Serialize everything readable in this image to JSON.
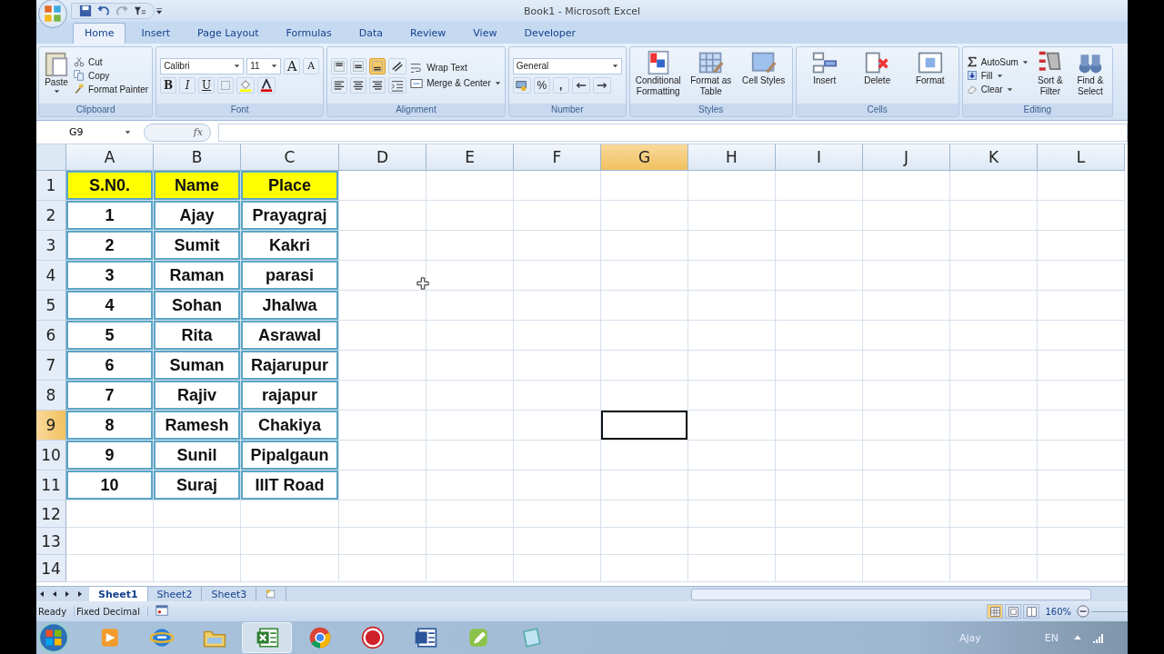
{
  "window": {
    "title": "Book1 - Microsoft Excel"
  },
  "tabs": [
    {
      "label": "Home",
      "selected": true
    },
    {
      "label": "Insert",
      "selected": false
    },
    {
      "label": "Page Layout",
      "selected": false
    },
    {
      "label": "Formulas",
      "selected": false
    },
    {
      "label": "Data",
      "selected": false
    },
    {
      "label": "Review",
      "selected": false
    },
    {
      "label": "View",
      "selected": false
    },
    {
      "label": "Developer",
      "selected": false
    }
  ],
  "ribbon": [
    {
      "kind": "clipboard",
      "label": "Clipboard",
      "paste": "Paste",
      "small": [
        "Cut",
        "Copy",
        "Format Painter"
      ]
    },
    {
      "kind": "font",
      "label": "Font",
      "font": "Calibri",
      "size": "11",
      "grow": "A",
      "shrink": "A",
      "styles": [
        "B",
        "I",
        "U"
      ]
    },
    {
      "kind": "alignment",
      "label": "Alignment",
      "vertical": [
        {
          "selected": false
        },
        {
          "selected": false
        },
        {
          "selected": true
        }
      ],
      "wrap": "Wrap Text",
      "merge": "Merge & Center"
    },
    {
      "kind": "number",
      "label": "Number",
      "format": "General",
      "percent": "%",
      "comma": ","
    },
    {
      "kind": "styles",
      "label": "Styles",
      "buttons": [
        "Conditional Formatting",
        "Format as Table",
        "Cell Styles"
      ]
    },
    {
      "kind": "cells",
      "label": "Cells",
      "buttons": [
        "Insert",
        "Delete",
        "Format"
      ]
    },
    {
      "kind": "editing",
      "label": "Editing",
      "small": [
        "AutoSum",
        "Fill",
        "Clear"
      ],
      "buttons": [
        "Sort & Filter",
        "Find & Select"
      ]
    }
  ],
  "formula_bar": {
    "name_box": "G9",
    "fx": "fx"
  },
  "columns": [
    {
      "label": "A",
      "selected": false
    },
    {
      "label": "B",
      "selected": false
    },
    {
      "label": "C",
      "selected": false
    },
    {
      "label": "D",
      "selected": false
    },
    {
      "label": "E",
      "selected": false
    },
    {
      "label": "F",
      "selected": false
    },
    {
      "label": "G",
      "selected": true
    },
    {
      "label": "H",
      "selected": false
    },
    {
      "label": "I",
      "selected": false
    },
    {
      "label": "J",
      "selected": false
    },
    {
      "label": "K",
      "selected": false
    },
    {
      "label": "L",
      "selected": false
    }
  ],
  "rows": [
    {
      "number": "1",
      "selected": false,
      "kind": "header",
      "cells": [
        "S.N0.",
        "Name",
        "Place"
      ]
    },
    {
      "number": "2",
      "selected": false,
      "kind": "data",
      "cells": [
        "1",
        "Ajay",
        "Prayagraj"
      ]
    },
    {
      "number": "3",
      "selected": false,
      "kind": "data",
      "cells": [
        "2",
        "Sumit",
        "Kakri"
      ]
    },
    {
      "number": "4",
      "selected": false,
      "kind": "data",
      "cells": [
        "3",
        "Raman",
        "parasi"
      ]
    },
    {
      "number": "5",
      "selected": false,
      "kind": "data",
      "cells": [
        "4",
        "Sohan",
        "Jhalwa"
      ]
    },
    {
      "number": "6",
      "selected": false,
      "kind": "data",
      "cells": [
        "5",
        "Rita",
        "Asrawal"
      ]
    },
    {
      "number": "7",
      "selected": false,
      "kind": "data",
      "cells": [
        "6",
        "Suman",
        "Rajarupur"
      ]
    },
    {
      "number": "8",
      "selected": false,
      "kind": "data",
      "cells": [
        "7",
        "Rajiv",
        "rajapur"
      ]
    },
    {
      "number": "9",
      "selected": true,
      "kind": "data",
      "cells": [
        "8",
        "Ramesh",
        "Chakiya"
      ]
    },
    {
      "number": "10",
      "selected": false,
      "kind": "data",
      "cells": [
        "9",
        "Sunil",
        "Pipalgaun"
      ]
    },
    {
      "number": "11",
      "selected": false,
      "kind": "data",
      "cells": [
        "10",
        "Suraj",
        "IIIT Road"
      ]
    },
    {
      "number": "12",
      "selected": false,
      "kind": "empty"
    },
    {
      "number": "13",
      "selected": false,
      "kind": "empty"
    },
    {
      "number": "14",
      "selected": false,
      "kind": "empty"
    }
  ],
  "sheets": [
    {
      "label": "Sheet1",
      "selected": true
    },
    {
      "label": "Sheet2",
      "selected": false
    },
    {
      "label": "Sheet3",
      "selected": false
    }
  ],
  "status_bar": {
    "items": [
      "Ready",
      "Fixed Decimal"
    ],
    "views": [
      {
        "selected": true
      },
      {
        "selected": false
      },
      {
        "selected": false
      }
    ],
    "zoom": "160%"
  },
  "taskbar": {
    "apps": [
      {
        "selected": false
      },
      {
        "selected": false
      },
      {
        "selected": false
      },
      {
        "selected": true
      },
      {
        "selected": false
      },
      {
        "selected": false
      },
      {
        "selected": false
      },
      {
        "selected": false
      },
      {
        "selected": false
      }
    ],
    "user": "Ajay",
    "language": "EN"
  }
}
